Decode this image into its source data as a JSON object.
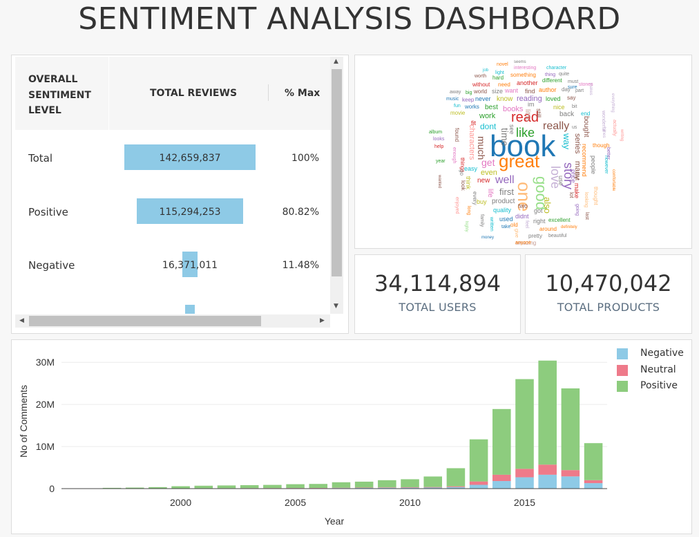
{
  "header": {
    "title": "SENTIMENT ANALYSIS DASHBOARD"
  },
  "table": {
    "columns": [
      "OVERALL SENTIMENT LEVEL",
      "TOTAL REVIEWS",
      "% Max"
    ],
    "rows": [
      {
        "label": "Total",
        "value": "142,659,837",
        "pct": "100%",
        "fraction": 1.0
      },
      {
        "label": "Positive",
        "value": "115,294,253",
        "pct": "80.82%",
        "fraction": 0.8082
      },
      {
        "label": "Negative",
        "value": "16,371,011",
        "pct": "11.48%",
        "fraction": 0.1148
      }
    ],
    "partial_row_fraction": 0.07
  },
  "wordcloud": {
    "words": [
      {
        "t": "book",
        "c": "#1f77b4"
      },
      {
        "t": "great",
        "c": "#ff7f0e"
      },
      {
        "t": "one",
        "c": "#ffbb78"
      },
      {
        "t": "good",
        "c": "#98df8a"
      },
      {
        "t": "like",
        "c": "#2ca02c"
      },
      {
        "t": "read",
        "c": "#d62728"
      },
      {
        "t": "story",
        "c": "#9467bd"
      },
      {
        "t": "love",
        "c": "#c5b0d5"
      },
      {
        "t": "well",
        "c": "#9467bd"
      },
      {
        "t": "really",
        "c": "#8c564b"
      },
      {
        "t": "time",
        "c": "#7f7f7f"
      },
      {
        "t": "much",
        "c": "#8c564b"
      },
      {
        "t": "get",
        "c": "#e377c2"
      },
      {
        "t": "also",
        "c": "#bcbd22"
      },
      {
        "t": "books",
        "c": "#e377c2"
      },
      {
        "t": "first",
        "c": "#7f7f7f"
      },
      {
        "t": "way",
        "c": "#17becf"
      },
      {
        "t": "dont",
        "c": "#17becf"
      },
      {
        "t": "work",
        "c": "#2ca02c"
      },
      {
        "t": "even",
        "c": "#bcbd22"
      },
      {
        "t": "new",
        "c": "#d62728"
      },
      {
        "t": "reading",
        "c": "#9467bd"
      },
      {
        "t": "series",
        "c": "#8c564b"
      },
      {
        "t": "many",
        "c": "#8c564b"
      },
      {
        "t": "characters",
        "c": "#ff9896"
      },
      {
        "t": "life",
        "c": "#e377c2"
      },
      {
        "t": "product",
        "c": "#7f7f7f"
      },
      {
        "t": "know",
        "c": "#bcbd22"
      },
      {
        "t": "little",
        "c": "#c49c94"
      },
      {
        "t": "never",
        "c": "#1f77b4"
      },
      {
        "t": "recommend",
        "c": "#ff7f0e"
      },
      {
        "t": "make",
        "c": "#d62728"
      },
      {
        "t": "bought",
        "c": "#8c564b"
      },
      {
        "t": "people",
        "c": "#7f7f7f"
      },
      {
        "t": "best",
        "c": "#2ca02c"
      },
      {
        "t": "back",
        "c": "#7f7f7f"
      },
      {
        "t": "nice",
        "c": "#bcbd22"
      },
      {
        "t": "author",
        "c": "#ff7f0e"
      },
      {
        "t": "loved",
        "c": "#2ca02c"
      },
      {
        "t": "another",
        "c": "#d62728"
      },
      {
        "t": "find",
        "c": "#8c564b"
      },
      {
        "t": "want",
        "c": "#e377c2"
      },
      {
        "t": "size",
        "c": "#7f7f7f"
      },
      {
        "t": "buy",
        "c": "#bcbd22"
      },
      {
        "t": "quality",
        "c": "#17becf"
      },
      {
        "t": "used",
        "c": "#1f77b4"
      },
      {
        "t": "two",
        "c": "#8c564b"
      },
      {
        "t": "got",
        "c": "#7f7f7f"
      },
      {
        "t": "excellent",
        "c": "#2ca02c"
      },
      {
        "t": "didnt",
        "c": "#9467bd"
      },
      {
        "t": "right",
        "c": "#7f7f7f"
      },
      {
        "t": "around",
        "c": "#ff7f0e"
      },
      {
        "t": "pretty",
        "c": "#7f7f7f"
      },
      {
        "t": "amazing",
        "c": "#c49c94"
      },
      {
        "t": "something",
        "c": "#ff7f0e"
      },
      {
        "t": "interesting",
        "c": "#e377c2"
      },
      {
        "t": "character",
        "c": "#17becf"
      },
      {
        "t": "different",
        "c": "#2ca02c"
      },
      {
        "t": "though",
        "c": "#ff7f0e"
      },
      {
        "t": "thought",
        "c": "#ffbb78"
      },
      {
        "t": "easy",
        "c": "#17becf"
      },
      {
        "t": "fit",
        "c": "#d62728"
      },
      {
        "t": "movie",
        "c": "#bcbd22"
      },
      {
        "t": "price",
        "c": "#9467bd"
      },
      {
        "t": "use",
        "c": "#7f7f7f"
      },
      {
        "t": "put",
        "c": "#8c564b"
      },
      {
        "t": "day",
        "c": "#7f7f7f"
      },
      {
        "t": "say",
        "c": "#8c564b"
      },
      {
        "t": "end",
        "c": "#17becf"
      },
      {
        "t": "music",
        "c": "#1f77b4"
      },
      {
        "t": "keep",
        "c": "#9467bd"
      },
      {
        "t": "job",
        "c": "#17becf"
      },
      {
        "t": "light",
        "c": "#17becf"
      },
      {
        "t": "novel",
        "c": "#ff7f0e"
      },
      {
        "t": "seems",
        "c": "#7f7f7f"
      },
      {
        "t": "worth",
        "c": "#8c564b"
      },
      {
        "t": "hard",
        "c": "#2ca02c"
      },
      {
        "t": "without",
        "c": "#d62728"
      },
      {
        "t": "need",
        "c": "#ff7f0e"
      },
      {
        "t": "world",
        "c": "#8c564b"
      },
      {
        "t": "fun",
        "c": "#17becf"
      },
      {
        "t": "works",
        "c": "#1f77b4"
      },
      {
        "t": "away",
        "c": "#7f7f7f"
      },
      {
        "t": "big",
        "c": "#2ca02c"
      },
      {
        "t": "part",
        "c": "#7f7f7f"
      },
      {
        "t": "must",
        "c": "#7f7f7f"
      },
      {
        "t": "sure",
        "c": "#1f77b4"
      },
      {
        "t": "stones",
        "c": "#e377c2"
      },
      {
        "t": "quite",
        "c": "#7f7f7f"
      },
      {
        "t": "thing",
        "c": "#9467bd"
      },
      {
        "t": "bit",
        "c": "#7f7f7f"
      },
      {
        "t": "us",
        "c": "#7f7f7f"
      },
      {
        "t": "album",
        "c": "#2ca02c"
      },
      {
        "t": "looks",
        "c": "#9467bd"
      },
      {
        "t": "help",
        "c": "#d62728"
      },
      {
        "t": "year",
        "c": "#2ca02c"
      },
      {
        "t": "found",
        "c": "#8c564b"
      },
      {
        "t": "enough",
        "c": "#e377c2"
      },
      {
        "t": "things",
        "c": "#d62728"
      },
      {
        "t": "think",
        "c": "#bcbd22"
      },
      {
        "t": "go",
        "c": "#7f7f7f"
      },
      {
        "t": "look",
        "c": "#8c564b"
      },
      {
        "t": "every",
        "c": "#7f7f7f"
      },
      {
        "t": "old",
        "c": "#ff7f0e"
      },
      {
        "t": "take",
        "c": "#1f77b4"
      },
      {
        "t": "money",
        "c": "#1f77b4"
      },
      {
        "t": "anyone",
        "c": "#ff7f0e"
      },
      {
        "t": "beautiful",
        "c": "#7f7f7f"
      },
      {
        "t": "definitely",
        "c": "#ff7f0e"
      },
      {
        "t": "looking",
        "c": "#ffbb78"
      },
      {
        "t": "going",
        "c": "#9467bd"
      },
      {
        "t": "enjoyed",
        "c": "#ff9896"
      },
      {
        "t": "family",
        "c": "#7f7f7f"
      },
      {
        "t": "long",
        "c": "#ff7f0e"
      },
      {
        "t": "give",
        "c": "#ffbb78"
      },
      {
        "t": "feel",
        "c": "#c5b0d5"
      },
      {
        "t": "written",
        "c": "#17becf"
      },
      {
        "t": "wonderful",
        "c": "#c5b0d5"
      },
      {
        "t": "actually",
        "c": "#ff9896"
      },
      {
        "t": "writing",
        "c": "#ff9896"
      },
      {
        "t": "comfortable",
        "c": "#ff7f0e"
      },
      {
        "t": "however",
        "c": "#17becf"
      },
      {
        "t": "better",
        "c": "#9467bd"
      },
      {
        "t": "times",
        "c": "#c5b0d5"
      },
      {
        "t": "everything",
        "c": "#c5b0d5"
      },
      {
        "t": "makes",
        "c": "#c5b0d5"
      },
      {
        "t": "wanted",
        "c": "#8c564b"
      },
      {
        "t": "highly",
        "c": "#98df8a"
      },
      {
        "t": "lot",
        "c": "#8c564b"
      },
      {
        "t": "last",
        "c": "#8c564b"
      },
      {
        "t": "see",
        "c": "#7f7f7f"
      },
      {
        "t": "im",
        "c": "#7f7f7f"
      },
      {
        "t": "still",
        "c": "#8c564b"
      }
    ]
  },
  "kpis": [
    {
      "value": "34,114,894",
      "label": "TOTAL USERS"
    },
    {
      "value": "10,470,042",
      "label": "TOTAL PRODUCTS"
    }
  ],
  "chart_data": {
    "type": "bar",
    "stacked": true,
    "xlabel": "Year",
    "ylabel": "No of Comments",
    "ylim": [
      0,
      32000000
    ],
    "yticks": [
      0,
      10000000,
      20000000,
      30000000
    ],
    "ytick_labels": [
      "0",
      "10M",
      "20M",
      "30M"
    ],
    "xticks": [
      2000,
      2005,
      2010,
      2015
    ],
    "grid": true,
    "legend_position": "top-right",
    "x": [
      1996,
      1997,
      1998,
      1999,
      2000,
      2001,
      2002,
      2003,
      2004,
      2005,
      2006,
      2007,
      2008,
      2009,
      2010,
      2011,
      2012,
      2013,
      2014,
      2015,
      2016,
      2017,
      2018
    ],
    "series": [
      {
        "name": "Negative",
        "color": "#8ecae6",
        "values": [
          5000,
          20000,
          30000,
          40000,
          50000,
          60000,
          70000,
          80000,
          90000,
          100000,
          110000,
          140000,
          170000,
          200000,
          220000,
          250000,
          350000,
          900000,
          1800000,
          2700000,
          3300000,
          2900000,
          1300000
        ]
      },
      {
        "name": "Neutral",
        "color": "#ee7a8a",
        "values": [
          3000,
          10000,
          15000,
          20000,
          25000,
          30000,
          35000,
          40000,
          45000,
          50000,
          55000,
          70000,
          85000,
          100000,
          110000,
          130000,
          200000,
          800000,
          1500000,
          2000000,
          2400000,
          1500000,
          700000
        ]
      },
      {
        "name": "Positive",
        "color": "#8dcc7e",
        "values": [
          30000,
          150000,
          200000,
          300000,
          500000,
          600000,
          650000,
          700000,
          750000,
          900000,
          950000,
          1300000,
          1400000,
          1700000,
          1900000,
          2500000,
          4300000,
          10000000,
          15600000,
          21300000,
          24700000,
          19400000,
          8800000
        ]
      }
    ]
  }
}
